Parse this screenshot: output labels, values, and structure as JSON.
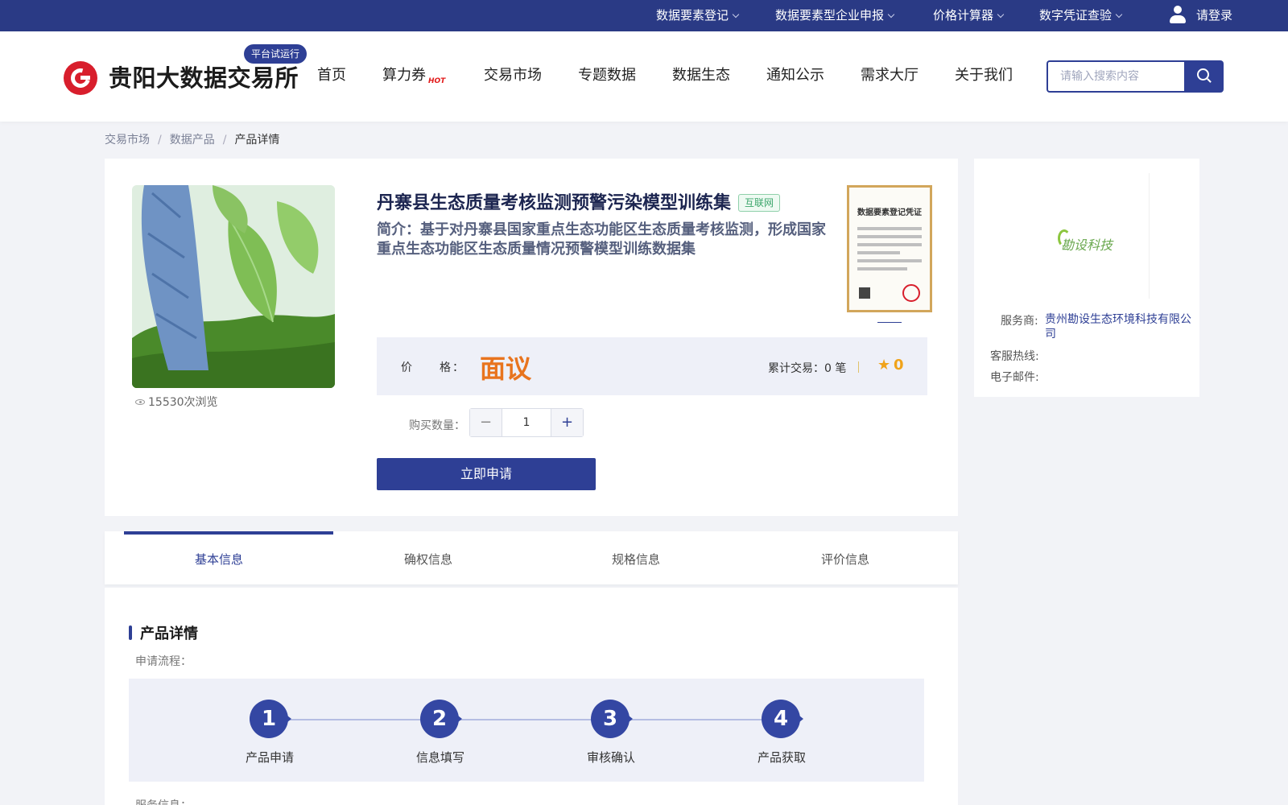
{
  "topbar": {
    "menus": [
      "数据要素登记",
      "数据要素型企业申报",
      "价格计算器",
      "数字凭证查验"
    ],
    "login_label": "请登录"
  },
  "header": {
    "logo_text": "贵阳大数据交易所",
    "trial_badge": "平台试运行",
    "nav": [
      "首页",
      "算力券",
      "交易市场",
      "专题数据",
      "数据生态",
      "通知公示",
      "需求大厅",
      "关于我们"
    ],
    "hot_badge": "HOT",
    "search_placeholder": "请输入搜索内容"
  },
  "breadcrumb": {
    "items": [
      "交易市场",
      "数据产品",
      "产品详情"
    ],
    "separator": "/"
  },
  "product": {
    "title": "丹寨县生态质量考核监测预警污染模型训练集",
    "tag": "互联网",
    "description": "简介：基于对丹寨县国家重点生态功能区生态质量考核监测，形成国家重点生态功能区生态质量情况预警模型训练数据集",
    "views": "15530次浏览",
    "certificate_title": "数据要素登记凭证",
    "price_label": "价　　格：",
    "price_value": "面议",
    "trade_count": "累计交易：0 笔",
    "rating": "0",
    "quantity_label": "购买数量：",
    "quantity": "1",
    "apply_button": "立即申请"
  },
  "provider": {
    "logo_text": "勘设科技",
    "service_label": "服务商:",
    "service_value": "贵州勘设生态环境科技有限公司",
    "hotline_label": "客服热线:",
    "email_label": "电子邮件:"
  },
  "tabs": [
    "基本信息",
    "确权信息",
    "规格信息",
    "评价信息"
  ],
  "detail": {
    "section_title": "产品详情",
    "flow_label": "申请流程：",
    "steps": [
      {
        "num": "1",
        "label": "产品申请"
      },
      {
        "num": "2",
        "label": "信息填写"
      },
      {
        "num": "3",
        "label": "审核确认"
      },
      {
        "num": "4",
        "label": "产品获取"
      }
    ],
    "next_label": "服务信息："
  },
  "colors": {
    "brand": "#2e3f95",
    "topbar": "#2a3a85",
    "price": "#e8741e",
    "logo_red": "#d81e2c"
  }
}
